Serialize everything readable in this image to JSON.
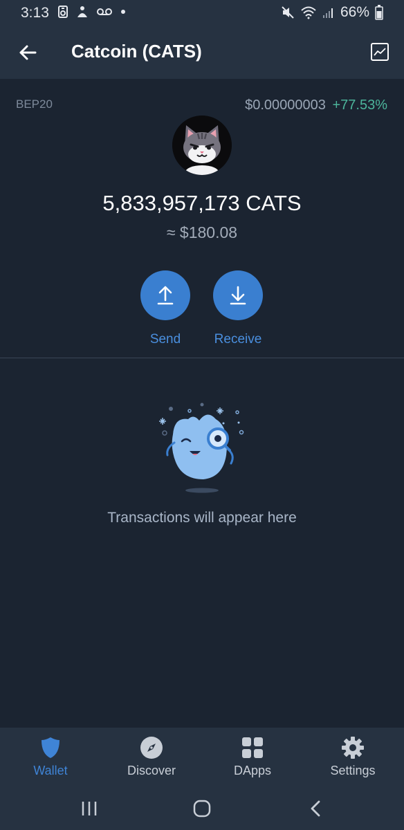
{
  "status_bar": {
    "time": "3:13",
    "battery": "66%",
    "icons": [
      "sim-icon",
      "notification-icon",
      "voicemail-icon",
      "dot-icon",
      "mute-icon",
      "wifi-icon",
      "signal-icon",
      "battery-icon"
    ]
  },
  "app_bar": {
    "title": "Catcoin (CATS)",
    "back_icon": "back-arrow-icon",
    "chart_icon": "chart-icon"
  },
  "token": {
    "network": "BEP20",
    "price": "$0.00000003",
    "change": "+77.53%",
    "balance": "5,833,957,173 CATS",
    "fiat_value": "≈ $180.08",
    "change_color": "#4cb59b"
  },
  "actions": {
    "send_label": "Send",
    "receive_label": "Receive"
  },
  "empty_state": {
    "message": "Transactions will appear here"
  },
  "bottom_nav": {
    "items": [
      {
        "label": "Wallet",
        "icon": "shield-icon",
        "active": true
      },
      {
        "label": "Discover",
        "icon": "compass-icon",
        "active": false
      },
      {
        "label": "DApps",
        "icon": "grid-icon",
        "active": false
      },
      {
        "label": "Settings",
        "icon": "gear-icon",
        "active": false
      }
    ]
  },
  "colors": {
    "accent": "#3a7fd0",
    "background": "#1b2431",
    "bar": "#263241"
  }
}
